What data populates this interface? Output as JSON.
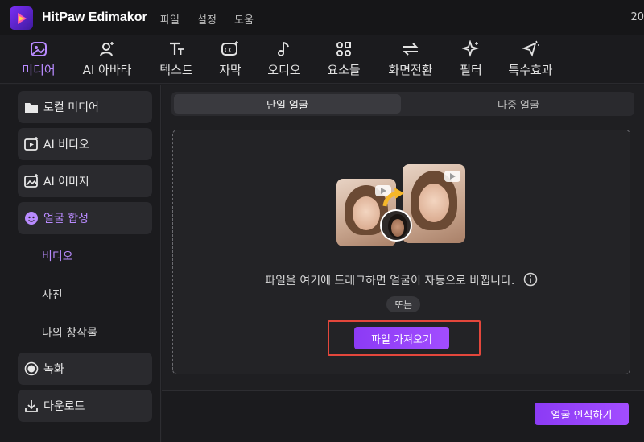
{
  "app": {
    "title": "HitPaw Edimakor",
    "menu": [
      "파일",
      "설정",
      "도움"
    ],
    "corner_text": "20"
  },
  "toolbar": {
    "items": [
      {
        "label": "미디어",
        "icon": "media-icon",
        "active": true
      },
      {
        "label": "AI 아바타",
        "icon": "avatar-icon",
        "active": false
      },
      {
        "label": "텍스트",
        "icon": "text-icon",
        "active": false
      },
      {
        "label": "자막",
        "icon": "caption-icon",
        "active": false
      },
      {
        "label": "오디오",
        "icon": "audio-icon",
        "active": false
      },
      {
        "label": "요소들",
        "icon": "elements-icon",
        "active": false
      },
      {
        "label": "화면전환",
        "icon": "transition-icon",
        "active": false
      },
      {
        "label": "필터",
        "icon": "filter-icon",
        "active": false
      },
      {
        "label": "특수효과",
        "icon": "effects-icon",
        "active": false
      }
    ]
  },
  "sidebar": {
    "items": [
      {
        "label": "로컬 미디어",
        "icon": "folder-icon"
      },
      {
        "label": "AI 비디오",
        "icon": "ai-video-icon"
      },
      {
        "label": "AI 이미지",
        "icon": "ai-image-icon"
      },
      {
        "label": "얼굴 합성",
        "icon": "face-swap-icon",
        "active": true
      }
    ],
    "subitems": [
      {
        "label": "비디오",
        "active": true
      },
      {
        "label": "사진",
        "active": false
      },
      {
        "label": "나의 창작물",
        "active": false
      }
    ],
    "bottom_items": [
      {
        "label": "녹화",
        "icon": "record-icon"
      },
      {
        "label": "다운로드",
        "icon": "download-icon"
      }
    ]
  },
  "main": {
    "tabs": [
      {
        "label": "단일 얼굴",
        "active": true
      },
      {
        "label": "다중 얼굴",
        "active": false
      }
    ],
    "drop_text": "파일을 여기에 드래그하면 얼굴이 자동으로 바뀝니다.",
    "or_text": "또는",
    "import_button": "파일 가져오기",
    "detect_button": "얼굴 인식하기"
  },
  "colors": {
    "accent": "#a24dff",
    "accent_text": "#b98bff",
    "highlight": "#e4473c",
    "background": "#1d1d20"
  }
}
